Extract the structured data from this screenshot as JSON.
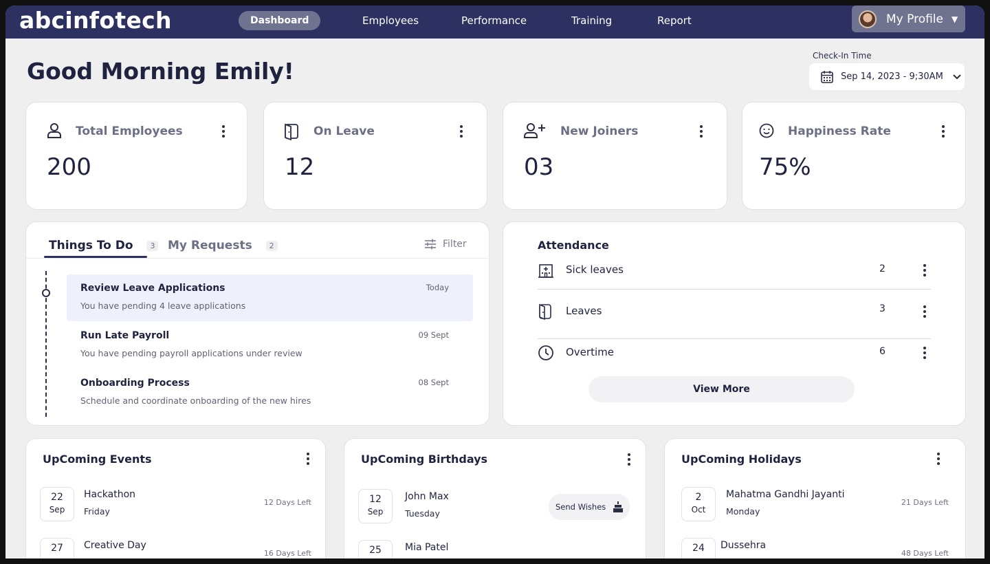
{
  "nav": {
    "logo": "abcinfotech",
    "links": [
      "Dashboard",
      "Employees",
      "Performance",
      "Training",
      "Report"
    ],
    "profile_label": "My Profile"
  },
  "header": {
    "greeting": "Good Morning Emily!",
    "checkin_label": "Check-In Time",
    "checkin_value": "Sep 14, 2023 - 9;30AM"
  },
  "stats": [
    {
      "title": "Total Employees",
      "value": "200",
      "icon": "user-icon"
    },
    {
      "title": "On Leave",
      "value": "12",
      "icon": "door-icon"
    },
    {
      "title": "New Joiners",
      "value": "03",
      "icon": "user-plus-icon"
    },
    {
      "title": "Happiness Rate",
      "value": "75%",
      "icon": "smile-icon"
    }
  ],
  "todo": {
    "tabs": [
      {
        "label": "Things To Do",
        "count": "3"
      },
      {
        "label": "My Requests",
        "count": "2"
      }
    ],
    "filter_label": "Filter",
    "tasks": [
      {
        "title": "Review Leave Applications",
        "desc": "You have pending 4 leave applications",
        "date": "Today"
      },
      {
        "title": "Run Late Payroll",
        "desc": "You have pending payroll applications under review",
        "date": "09 Sept"
      },
      {
        "title": "Onboarding Process",
        "desc": "Schedule and coordinate onboarding of the new hires",
        "date": "08 Sept"
      }
    ]
  },
  "attendance": {
    "title": "Attendance",
    "rows": [
      {
        "label": "Sick leaves",
        "value": "2",
        "icon": "hospital-icon"
      },
      {
        "label": "Leaves",
        "value": "3",
        "icon": "door-icon"
      },
      {
        "label": "Overtime",
        "value": "6",
        "icon": "clock-icon"
      }
    ],
    "view_more": "View More"
  },
  "events": {
    "title": "UpComing Events",
    "items": [
      {
        "day": "22",
        "month": "Sep",
        "name": "Hackathon",
        "sub": "Friday",
        "left": "12 Days Left"
      },
      {
        "day": "27",
        "month": "",
        "name": "Creative Day",
        "sub": "",
        "left": "16 Days Left"
      }
    ]
  },
  "birthdays": {
    "title": "UpComing Birthdays",
    "send_wishes": "Send Wishes",
    "items": [
      {
        "day": "12",
        "month": "Sep",
        "name": "John Max",
        "sub": "Tuesday"
      },
      {
        "day": "25",
        "month": "",
        "name": "Mia Patel",
        "sub": ""
      }
    ]
  },
  "holidays": {
    "title": "UpComing Holidays",
    "items": [
      {
        "day": "2",
        "month": "Oct",
        "name": "Mahatma Gandhi Jayanti",
        "sub": "Monday",
        "left": "21 Days Left"
      },
      {
        "day": "24",
        "month": "",
        "name": "Dussehra",
        "sub": "",
        "left": "48 Days Left"
      }
    ]
  },
  "colors": {
    "nav_bg": "#2c3161",
    "nav_active": "#6f7390",
    "page_bg": "#efefef",
    "highlight": "#eef1fb"
  }
}
